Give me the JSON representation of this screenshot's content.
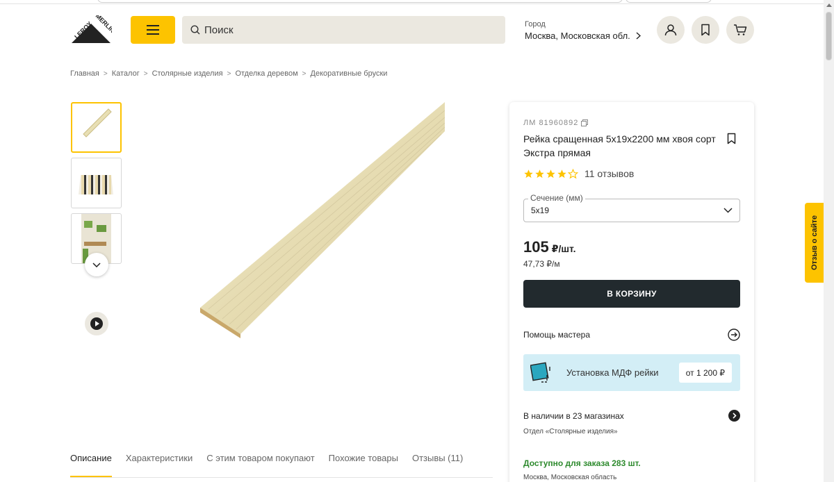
{
  "colors": {
    "accent": "#fdc300",
    "dark": "#222a2e",
    "search_bg": "#ebe8e0",
    "service_bg": "#d3eef6",
    "available": "#2d8a2d"
  },
  "header": {
    "logo_text": "LEROY MERLIN",
    "search_placeholder": "Поиск",
    "city_label": "Город",
    "city_value": "Москва, Московская обл."
  },
  "breadcrumb": [
    "Главная",
    "Каталог",
    "Столярные изделия",
    "Отделка деревом",
    "Декоративные бруски"
  ],
  "product": {
    "code": "ЛМ 81960892",
    "title": "Рейка сращенная 5x19x2200 мм хвоя сорт Экстра прямая",
    "rating": 4,
    "reviews": "11 отзывов",
    "section_label": "Сечение (мм)",
    "section_value": "5x19",
    "price": "105",
    "price_unit": "₽/шт.",
    "price_per_meter": "47,73 ₽/м",
    "cart_button": "В КОРЗИНУ",
    "help_label": "Помощь мастера",
    "service_label": "Установка МДФ рейки",
    "service_price": "от 1 200 ₽",
    "stock_label": "В наличии в 23 магазинах",
    "department": "Отдел «Столярные изделия»",
    "available": "Доступно для заказа 283 шт.",
    "region": "Москва, Московская область"
  },
  "tabs": [
    "Описание",
    "Характеристики",
    "С этим товаром покупают",
    "Похожие товары",
    "Отзывы (11)"
  ],
  "feedback": "Отзыв о сайте"
}
